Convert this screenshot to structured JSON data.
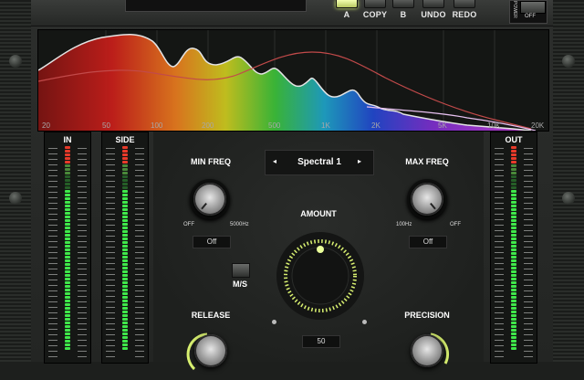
{
  "toolbar": {
    "buttons": [
      {
        "label": "A",
        "active": true
      },
      {
        "label": "COPY",
        "active": false
      },
      {
        "label": "B",
        "active": false
      },
      {
        "label": "UNDO",
        "active": false
      },
      {
        "label": "REDO",
        "active": false
      }
    ],
    "power": {
      "label": "POWER",
      "state": "OFF"
    }
  },
  "spectrum": {
    "freq_labels": [
      "20",
      "50",
      "100",
      "200",
      "500",
      "1K",
      "2K",
      "5K",
      "10K",
      "20K"
    ]
  },
  "meters": {
    "in": "IN",
    "side": "SIDE",
    "out": "OUT"
  },
  "preset": {
    "name": "Spectral 1",
    "prev_icon": "◂",
    "next_icon": "▸"
  },
  "controls": {
    "min_freq": {
      "label": "MIN FREQ",
      "min": "OFF",
      "max": "5000Hz",
      "value": "Off"
    },
    "max_freq": {
      "label": "MAX FREQ",
      "min": "100Hz",
      "max": "OFF",
      "value": "Off"
    },
    "amount": {
      "label": "AMOUNT",
      "value": "50"
    },
    "ms": {
      "label": "M/S"
    },
    "release": {
      "label": "RELEASE"
    },
    "precision": {
      "label": "PRECISION"
    }
  },
  "colors": {
    "accent": "#d8f070",
    "meter_green": "#3fe84a",
    "meter_red": "#e83a2a"
  }
}
